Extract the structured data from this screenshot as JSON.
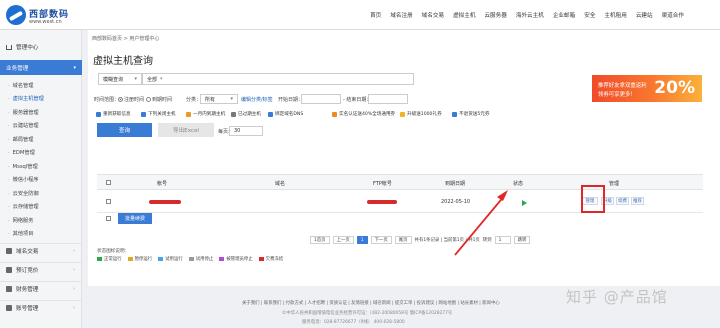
{
  "topbar": {
    "logo_text": "西部数码",
    "logo_url": "www.west.cn",
    "nav": [
      "首页",
      "域名注册",
      "域名交易",
      "虚拟主机",
      "云服务器",
      "海外云主机",
      "企业邮箱",
      "安全",
      "主机租用",
      "云建站",
      "渠道合作"
    ]
  },
  "sidebar": {
    "home": "管理中心",
    "business": "业务管理",
    "sub_items": [
      "域名管理",
      "虚拟主机管理",
      "服务器管理",
      "云建站管理",
      "邮局管理",
      "EDM管理",
      "Mssql管理",
      "微信小程序",
      "云安全防御",
      "云存储管理",
      "网络服务",
      "其他项目"
    ],
    "active_index": 1,
    "categories": [
      "域名交易",
      "预订竞价",
      "财务管理",
      "账号管理"
    ]
  },
  "content": {
    "breadcrumb": "西部数码首页 > 用户管理中心",
    "title": "虚拟主机查询",
    "filter": {
      "search_type": "模糊查询",
      "scope": "全部",
      "time_label": "时间范围：",
      "radio_reg": "注册时间",
      "radio_exp": "到期时间",
      "category_label": "分类：",
      "category_value": "所有",
      "tag_link": "编辑分类/标签",
      "start_label": "开始日期：",
      "end_label": "- 结束日期："
    },
    "actions": [
      "重新获取信息",
      "下列关闭主机",
      "一月内到期主机",
      "已过期主机",
      "绑定域名DNS",
      "实名认证送40%全场通用券",
      "升级送1000礼券",
      "不退货送5元券"
    ],
    "query_button": "查询",
    "export_button": "导出Excel",
    "per_page_label": "每页:",
    "per_page_value": "30",
    "table": {
      "headers": [
        "帐号",
        "域名",
        "FTP帐号",
        "到期日期",
        "状态",
        "管理"
      ],
      "row": {
        "expiry": "2022-05-10",
        "manage_buttons": [
          "管理",
          "升级",
          "续费",
          "推荐"
        ]
      }
    },
    "renew_button": "批量续费",
    "pager": [
      "1首页",
      "上一页",
      "1",
      "下一页",
      "尾页",
      "共有1条记录 | 当前第1页 | 共1页",
      "转到",
      "1",
      "跳转"
    ],
    "legend_title": "状态图标说明：",
    "legend": [
      "正常运行",
      "暂停运行",
      "试用运行",
      "试用停止",
      "被管理员停止",
      "欠费冻结"
    ]
  },
  "banner": {
    "line1": "推荐好友拿双重返利",
    "line2": "领券可享更多！",
    "big": "20%"
  },
  "footer": {
    "links": "关于我们 | 联系我们 | 付款方式 | 人才招聘 | 资质认证 | 友情链接 | 域名新闻 | 提交工单 | 投诉建议 | 网站地图 | 站长素材 | 新闻中心",
    "icp": "©中华人民共和国增值电信业务经营许可证：川B2-20080058号 蜀ICP备12028277号",
    "phone": "服务电话：028-87726677（9线） 400-028-5800"
  },
  "watermark": "知乎 @产品馆",
  "colors": {
    "accent": "#3a7bd5",
    "highlight": "#e12828",
    "status_ok": "#2aa84a"
  }
}
